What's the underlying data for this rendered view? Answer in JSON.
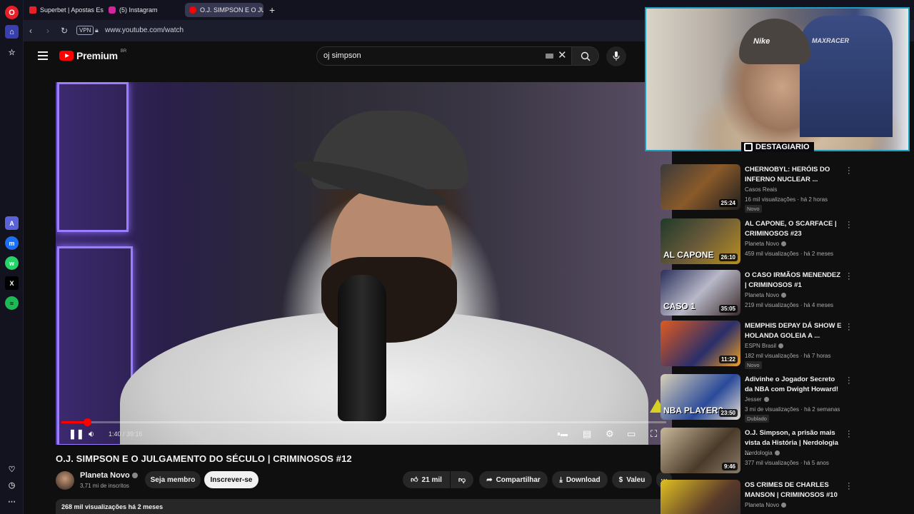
{
  "browser": {
    "tabs": [
      {
        "label": "Superbet | Apostas Esport",
        "color": "#e8202a"
      },
      {
        "label": "(5) Instagram",
        "color": "#d6249f"
      },
      {
        "label": "O.J. SIMPSON E O JU...",
        "color": "#ff0000"
      }
    ],
    "url": "www.youtube.com/watch",
    "vpn": "VPN"
  },
  "youtube": {
    "logo_text": "Premium",
    "region": "BR",
    "search_value": "oj simpson"
  },
  "player": {
    "time": "1:40 / 39:16",
    "progress_fraction": 0.042
  },
  "video": {
    "title": "O.J. SIMPSON E O JULGAMENTO DO SÉCULO | CRIMINOSOS #12",
    "channel": "Planeta Novo",
    "subscribers": "3,71 mi de inscritos",
    "join_label": "Seja membro",
    "subscribe_label": "Inscrever-se",
    "likes": "21 mil",
    "share_label": "Compartilhar",
    "download_label": "Download",
    "thanks_label": "Valeu",
    "views": "268 mil visualizações",
    "date": "há 2 meses"
  },
  "webcam": {
    "cap_text": "Nike",
    "chair_text": "MAXRACER",
    "streamer": "DESTAGIARIO"
  },
  "recommendations": [
    {
      "title": "CHERNOBYL: HERÓIS DO INFERNO NUCLEAR ...",
      "channel": "Casos Reais",
      "stats": "16 mil visualizações · há 2 horas",
      "duration": "25:24",
      "badge": "Novo",
      "thumb_text": "",
      "verified": false
    },
    {
      "title": "AL CAPONE, O SCARFACE | CRIMINOSOS #23",
      "channel": "Planeta Novo",
      "stats": "459 mil visualizações · há 2 meses",
      "duration": "26:10",
      "badge": "",
      "thumb_text": "AL CAPONE",
      "verified": true
    },
    {
      "title": "O CASO IRMÃOS MENENDEZ | CRIMINOSOS #1",
      "channel": "Planeta Novo",
      "stats": "219 mil visualizações · há 4 meses",
      "duration": "35:05",
      "badge": "",
      "thumb_text": "CASO 1",
      "verified": true
    },
    {
      "title": "MEMPHIS DEPAY DÁ SHOW E HOLANDA GOLEIA A ...",
      "channel": "ESPN Brasil",
      "stats": "182 mil visualizações · há 7 horas",
      "duration": "11:22",
      "badge": "Novo",
      "thumb_text": "",
      "verified": true
    },
    {
      "title": "Adivinhe o Jogador Secreto da NBA com Dwight Howard!",
      "channel": "Jesser",
      "stats": "3 mi de visualizações · há 2 semanas",
      "duration": "23:50",
      "badge": "Dublado",
      "thumb_text": "NBA PLAYER?",
      "verified": true
    },
    {
      "title": "O.J. Simpson, a prisão mais vista da História | Nerdologia ...",
      "channel": "Nerdologia",
      "stats": "377 mil visualizações · há 5 anos",
      "duration": "9:46",
      "badge": "",
      "thumb_text": "",
      "verified": true
    },
    {
      "title": "OS CRIMES DE CHARLES MANSON | CRIMINOSOS #10",
      "channel": "Planeta Novo",
      "stats": "",
      "duration": "",
      "badge": "",
      "thumb_text": "",
      "verified": true
    }
  ]
}
